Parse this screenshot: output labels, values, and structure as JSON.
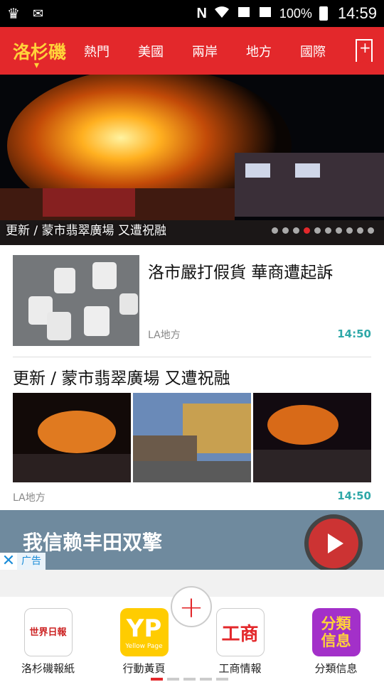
{
  "status_bar": {
    "battery": "100%",
    "time": "14:59",
    "icons": [
      "crown-icon",
      "mail-icon",
      "nfc-icon",
      "wifi-icon",
      "signal-icon",
      "battery-icon"
    ]
  },
  "nav": {
    "logo": "洛杉磯",
    "tabs": [
      "熱門",
      "美國",
      "兩岸",
      "地方",
      "國際"
    ],
    "accent": "#e3282b",
    "logo_color": "#ffd33a"
  },
  "hero": {
    "caption": "更新 / 蒙市翡翠廣場 又遭祝融",
    "dot_count": 10,
    "active_dot": 4
  },
  "articles": [
    {
      "title": "洛市嚴打假貨 華商遭起訴",
      "source": "LA地方",
      "time": "14:50"
    },
    {
      "title": "更新 / 蒙市翡翠廣場 又遭祝融",
      "source": "LA地方",
      "time": "14:50"
    }
  ],
  "ad": {
    "text": "我信赖丰田双擎",
    "label": "广告",
    "close": "✕"
  },
  "bottom_apps": [
    {
      "label": "洛杉磯報紙",
      "icon_text": "世界日報"
    },
    {
      "label": "行動黃頁",
      "icon_text": "YP",
      "icon_sub": "Yellow Page"
    },
    {
      "label": "工商情報",
      "icon_text": "工商"
    },
    {
      "label": "分類信息",
      "icon_text": "分類信息"
    }
  ],
  "fab": "+"
}
